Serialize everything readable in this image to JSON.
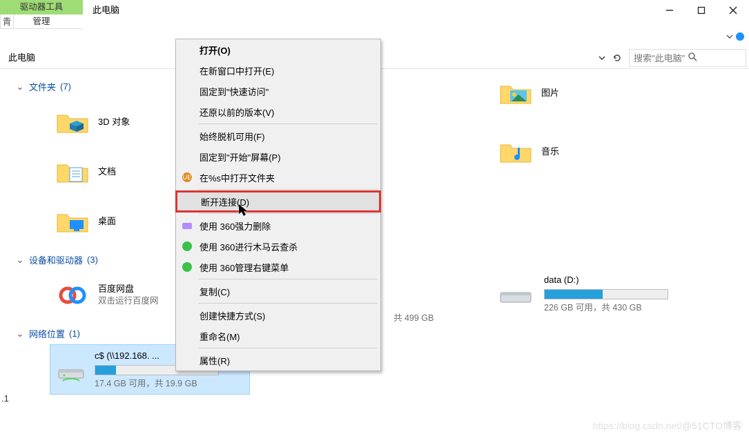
{
  "window": {
    "title_tab": "此电脑",
    "ribbon_drive_tools": "驱动器工具",
    "ribbon_manage": "管理",
    "small_left_char": "青"
  },
  "toolbar": {
    "breadcrumb": "此电脑",
    "search_placeholder": "搜索\"此电脑\""
  },
  "groups": {
    "folders": {
      "label": "文件夹",
      "count": "(7)"
    },
    "devices": {
      "label": "设备和驱动器",
      "count": "(3)"
    },
    "network": {
      "label": "网络位置",
      "count": "(1)"
    }
  },
  "folders": {
    "objects3d": "3D 对象",
    "documents": "文档",
    "desktop": "桌面",
    "pictures": "图片",
    "music": "音乐"
  },
  "devices": {
    "baidu": {
      "title": "百度网盘",
      "subtitle": "双击运行百度网"
    },
    "c_drive": {
      "size_text": "共 499 GB"
    },
    "d_drive": {
      "title": "data (D:)",
      "size_text": "226 GB 可用，共 430 GB",
      "used_pct": 47
    }
  },
  "network_drive": {
    "title": "c$ (\\\\192.168. ...",
    "size_text": "17.4 GB 可用，共 19.9 GB",
    "used_pct": 17
  },
  "context_menu": {
    "open": "打开(O)",
    "open_new_window": "在新窗口中打开(E)",
    "pin_quick": "固定到\"快速访问\"",
    "restore_prev": "还原以前的版本(V)",
    "always_offline": "始终脱机可用(F)",
    "pin_start": "固定到\"开始\"屏幕(P)",
    "ue_open": "在%s中打开文件夹",
    "disconnect": "断开连接(D)",
    "san60_delete": "使用 360强力删除",
    "san60_scan": "使用 360进行木马云查杀",
    "san60_menu": "使用 360管理右键菜单",
    "copy": "复制(C)",
    "create_shortcut": "创建快捷方式(S)",
    "rename": "重命名(M)",
    "properties": "属性(R)"
  },
  "footer_left": ".1",
  "watermark": "@51CTO博客"
}
